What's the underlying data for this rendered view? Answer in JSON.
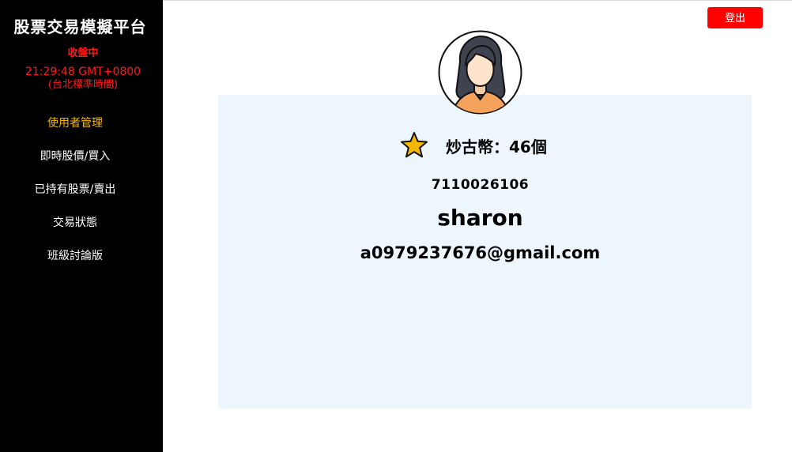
{
  "app": {
    "title": "股票交易模擬平台"
  },
  "market": {
    "status": "收盤中",
    "time": "21:29:48 GMT+0800",
    "timezone": "(台北標準時間)"
  },
  "sidebar": {
    "items": [
      {
        "label": "使用者管理",
        "active": true
      },
      {
        "label": "即時股價/買入",
        "active": false
      },
      {
        "label": "已持有股票/賣出",
        "active": false
      },
      {
        "label": "交易狀態",
        "active": false
      },
      {
        "label": "班級討論版",
        "active": false
      }
    ]
  },
  "header": {
    "logout_label": "登出"
  },
  "profile": {
    "coins_label": "炒古幣：",
    "coins_value": "46個",
    "student_id": "7110026106",
    "username": "sharon",
    "email": "a0979237676@gmail.com"
  },
  "icons": {
    "avatar": "woman-avatar-icon",
    "coin": "star-icon"
  },
  "colors": {
    "sidebar_bg": "#000000",
    "active_nav": "#f5b800",
    "market_status": "#ff1a1a",
    "logout_bg": "#ff0000",
    "card_bg": "#eef6fd",
    "star": "#f5b800"
  }
}
